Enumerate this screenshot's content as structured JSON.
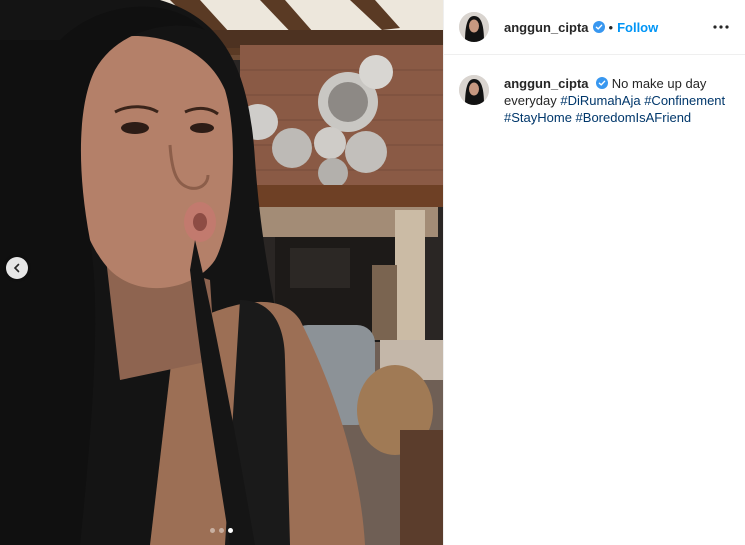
{
  "post": {
    "username": "anggun_cipta",
    "separator": "•",
    "follow_label": "Follow",
    "caption_text": "No make up day everyday",
    "hashtags": [
      "#DiRumahAja",
      "#Confinement",
      "#StayHome",
      "#BoredomIsAFriend"
    ],
    "carousel": {
      "total": 3,
      "active": 3
    }
  },
  "icons": {
    "verified": "verified-badge-icon",
    "more": "more-options-icon",
    "prev": "chevron-left-icon"
  },
  "colors": {
    "link": "#0095f6",
    "hashtag": "#00376b",
    "text": "#262626"
  }
}
